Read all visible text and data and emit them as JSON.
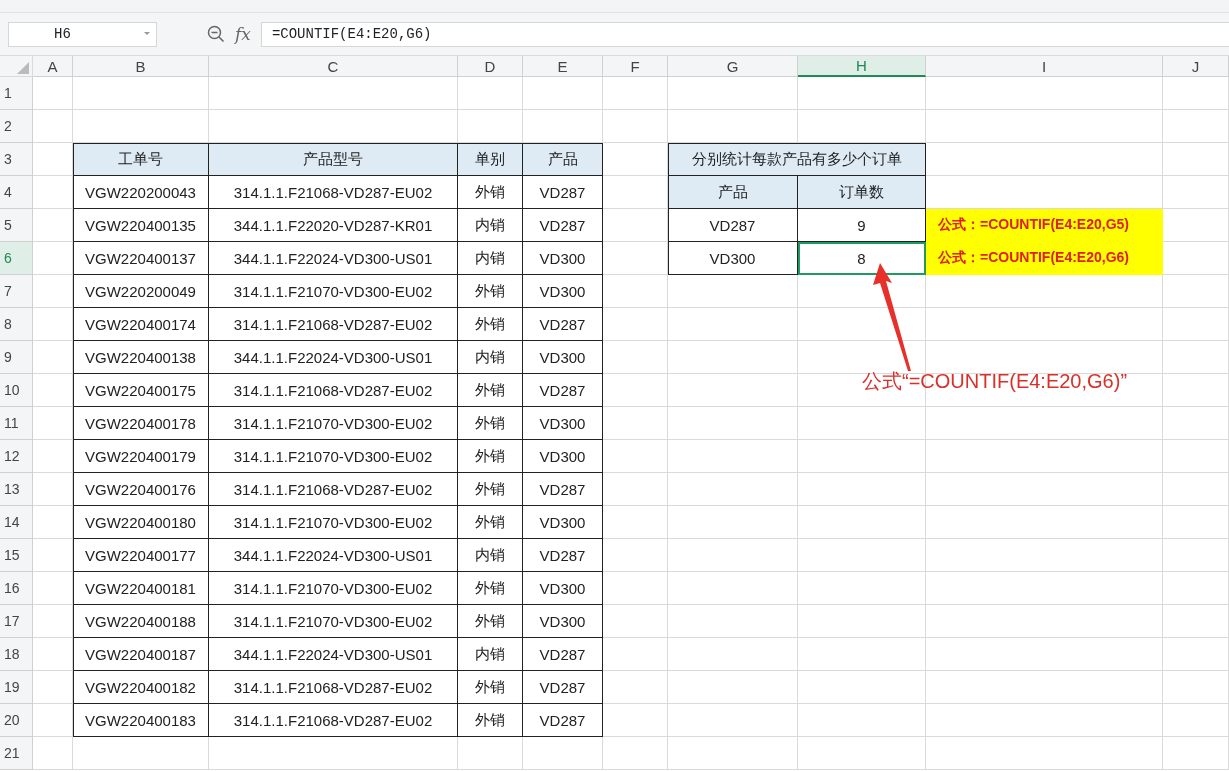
{
  "name_box": {
    "value": "H6"
  },
  "formula_bar": {
    "function_label": "fx",
    "value": "=COUNTIF(E4:E20,G6)"
  },
  "columns": [
    {
      "label": "A",
      "selected": false
    },
    {
      "label": "B",
      "selected": false
    },
    {
      "label": "C",
      "selected": false
    },
    {
      "label": "D",
      "selected": false
    },
    {
      "label": "E",
      "selected": false
    },
    {
      "label": "F",
      "selected": false
    },
    {
      "label": "G",
      "selected": false
    },
    {
      "label": "H",
      "selected": true
    },
    {
      "label": "I",
      "selected": false
    },
    {
      "label": "J",
      "selected": false
    }
  ],
  "rows": [
    {
      "label": "1",
      "selected": false
    },
    {
      "label": "2",
      "selected": false
    },
    {
      "label": "3",
      "selected": false
    },
    {
      "label": "4",
      "selected": false
    },
    {
      "label": "5",
      "selected": false
    },
    {
      "label": "6",
      "selected": true
    },
    {
      "label": "7",
      "selected": false
    },
    {
      "label": "8",
      "selected": false
    },
    {
      "label": "9",
      "selected": false
    },
    {
      "label": "10",
      "selected": false
    },
    {
      "label": "11",
      "selected": false
    },
    {
      "label": "12",
      "selected": false
    },
    {
      "label": "13",
      "selected": false
    },
    {
      "label": "14",
      "selected": false
    },
    {
      "label": "15",
      "selected": false
    },
    {
      "label": "16",
      "selected": false
    },
    {
      "label": "17",
      "selected": false
    },
    {
      "label": "18",
      "selected": false
    },
    {
      "label": "19",
      "selected": false
    },
    {
      "label": "20",
      "selected": false
    },
    {
      "label": "21",
      "selected": false
    }
  ],
  "order_table": {
    "columns": [
      "工单号",
      "产品型号",
      "单别",
      "产品"
    ],
    "rows": [
      [
        "VGW220200043",
        "314.1.1.F21068-VD287-EU02",
        "外销",
        "VD287"
      ],
      [
        "VGW220400135",
        "344.1.1.F22020-VD287-KR01",
        "内销",
        "VD287"
      ],
      [
        "VGW220400137",
        "344.1.1.F22024-VD300-US01",
        "内销",
        "VD300"
      ],
      [
        "VGW220200049",
        "314.1.1.F21070-VD300-EU02",
        "外销",
        "VD300"
      ],
      [
        "VGW220400174",
        "314.1.1.F21068-VD287-EU02",
        "外销",
        "VD287"
      ],
      [
        "VGW220400138",
        "344.1.1.F22024-VD300-US01",
        "内销",
        "VD300"
      ],
      [
        "VGW220400175",
        "314.1.1.F21068-VD287-EU02",
        "外销",
        "VD287"
      ],
      [
        "VGW220400178",
        "314.1.1.F21070-VD300-EU02",
        "外销",
        "VD300"
      ],
      [
        "VGW220400179",
        "314.1.1.F21070-VD300-EU02",
        "外销",
        "VD300"
      ],
      [
        "VGW220400176",
        "314.1.1.F21068-VD287-EU02",
        "外销",
        "VD287"
      ],
      [
        "VGW220400180",
        "314.1.1.F21070-VD300-EU02",
        "外销",
        "VD300"
      ],
      [
        "VGW220400177",
        "344.1.1.F22024-VD300-US01",
        "内销",
        "VD287"
      ],
      [
        "VGW220400181",
        "314.1.1.F21070-VD300-EU02",
        "外销",
        "VD300"
      ],
      [
        "VGW220400188",
        "314.1.1.F21070-VD300-EU02",
        "外销",
        "VD300"
      ],
      [
        "VGW220400187",
        "344.1.1.F22024-VD300-US01",
        "内销",
        "VD287"
      ],
      [
        "VGW220400182",
        "314.1.1.F21068-VD287-EU02",
        "外销",
        "VD287"
      ],
      [
        "VGW220400183",
        "314.1.1.F21068-VD287-EU02",
        "外销",
        "VD287"
      ]
    ]
  },
  "summary_table": {
    "title": "分别统计每款产品有多少个订单",
    "columns": [
      "产品",
      "订单数"
    ],
    "rows": [
      {
        "product": "VD287",
        "count": "9",
        "selected": false
      },
      {
        "product": "VD300",
        "count": "8",
        "selected": true
      }
    ]
  },
  "formula_notes": [
    "公式：=COUNTIF(E4:E20,G5)",
    "公式：=COUNTIF(E4:E20,G6)"
  ],
  "annotation": {
    "text": "公式“=COUNTIF(E4:E20,G6)”"
  }
}
